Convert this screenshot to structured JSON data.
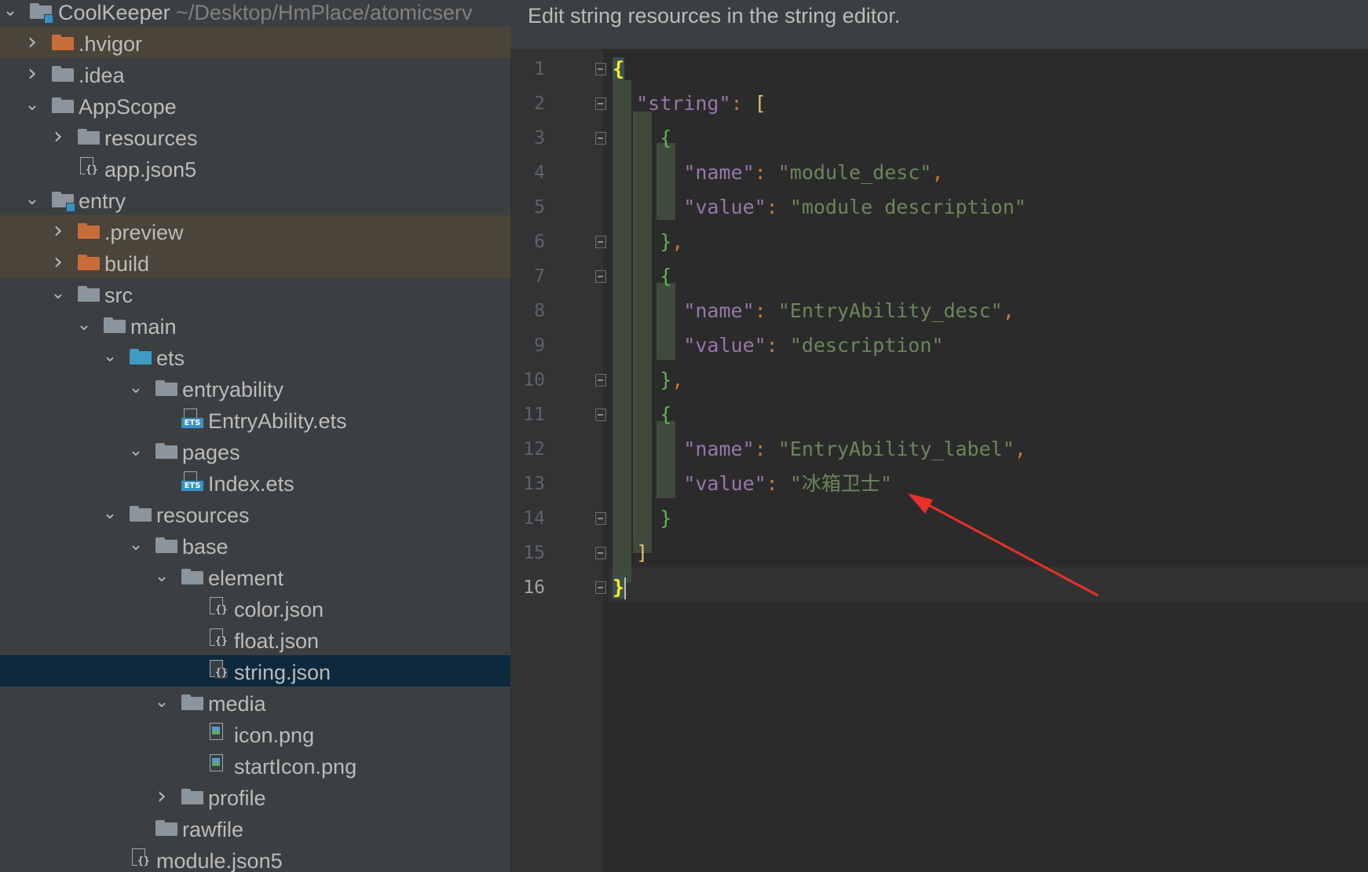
{
  "project": {
    "name": "CoolKeeper",
    "path": "~/Desktop/HmPlace/atomicserv"
  },
  "tree": [
    {
      "label": ".hvigor",
      "depth": 1,
      "icon": "folder-excluded-icon",
      "expanded": false,
      "state": "excluded"
    },
    {
      "label": ".idea",
      "depth": 1,
      "icon": "folder-icon",
      "expanded": false
    },
    {
      "label": "AppScope",
      "depth": 1,
      "icon": "folder-icon",
      "expanded": true
    },
    {
      "label": "resources",
      "depth": 2,
      "icon": "folder-icon",
      "expanded": false
    },
    {
      "label": "app.json5",
      "depth": 2,
      "icon": "json-file-icon"
    },
    {
      "label": "entry",
      "depth": 1,
      "icon": "module-folder-icon",
      "expanded": true
    },
    {
      "label": ".preview",
      "depth": 2,
      "icon": "folder-excluded-icon",
      "expanded": false,
      "state": "excluded"
    },
    {
      "label": "build",
      "depth": 2,
      "icon": "folder-excluded-icon",
      "expanded": false,
      "state": "excluded"
    },
    {
      "label": "src",
      "depth": 2,
      "icon": "folder-icon",
      "expanded": true
    },
    {
      "label": "main",
      "depth": 3,
      "icon": "folder-icon",
      "expanded": true
    },
    {
      "label": "ets",
      "depth": 4,
      "icon": "source-folder-icon",
      "expanded": true
    },
    {
      "label": "entryability",
      "depth": 5,
      "icon": "folder-icon",
      "expanded": true
    },
    {
      "label": "EntryAbility.ets",
      "depth": 6,
      "icon": "ets-file-icon"
    },
    {
      "label": "pages",
      "depth": 5,
      "icon": "folder-icon",
      "expanded": true
    },
    {
      "label": "Index.ets",
      "depth": 6,
      "icon": "ets-file-icon"
    },
    {
      "label": "resources",
      "depth": 4,
      "icon": "folder-icon",
      "expanded": true
    },
    {
      "label": "base",
      "depth": 5,
      "icon": "folder-icon",
      "expanded": true
    },
    {
      "label": "element",
      "depth": 6,
      "icon": "folder-icon",
      "expanded": true
    },
    {
      "label": "color.json",
      "depth": 7,
      "icon": "json-file-icon"
    },
    {
      "label": "float.json",
      "depth": 7,
      "icon": "json-file-icon"
    },
    {
      "label": "string.json",
      "depth": 7,
      "icon": "json-file-icon",
      "state": "selected"
    },
    {
      "label": "media",
      "depth": 6,
      "icon": "folder-icon",
      "expanded": true
    },
    {
      "label": "icon.png",
      "depth": 7,
      "icon": "image-file-icon"
    },
    {
      "label": "startIcon.png",
      "depth": 7,
      "icon": "image-file-icon"
    },
    {
      "label": "profile",
      "depth": 6,
      "icon": "folder-icon",
      "expanded": false
    },
    {
      "label": "rawfile",
      "depth": 5,
      "icon": "folder-icon"
    },
    {
      "label": "module.json5",
      "depth": 4,
      "icon": "json-file-icon"
    }
  ],
  "editor": {
    "banner": "Edit string resources in the string editor.",
    "current_line": 16,
    "line_numbers": [
      "1",
      "2",
      "3",
      "4",
      "5",
      "6",
      "7",
      "8",
      "9",
      "10",
      "11",
      "12",
      "13",
      "14",
      "15",
      "16"
    ],
    "lines": [
      {
        "n": "1",
        "text": "{"
      },
      {
        "n": "2",
        "text": "  \"string\": ["
      },
      {
        "n": "3",
        "text": "    {"
      },
      {
        "n": "4",
        "text": "      \"name\": \"module_desc\","
      },
      {
        "n": "5",
        "text": "      \"value\": \"module description\""
      },
      {
        "n": "6",
        "text": "    },"
      },
      {
        "n": "7",
        "text": "    {"
      },
      {
        "n": "8",
        "text": "      \"name\": \"EntryAbility_desc\","
      },
      {
        "n": "9",
        "text": "      \"value\": \"description\""
      },
      {
        "n": "10",
        "text": "    },"
      },
      {
        "n": "11",
        "text": "    {"
      },
      {
        "n": "12",
        "text": "      \"name\": \"EntryAbility_label\","
      },
      {
        "n": "13",
        "text": "      \"value\": \"冰箱卫士\""
      },
      {
        "n": "14",
        "text": "    }"
      },
      {
        "n": "15",
        "text": "  ]"
      },
      {
        "n": "16",
        "text": "}"
      }
    ],
    "tokens": {
      "key_string": "\"string\"",
      "key_name": "\"name\"",
      "key_value": "\"value\"",
      "colon": ": ",
      "comma": ",",
      "val_module_desc": "\"module_desc\"",
      "val_module_description": "\"module description\"",
      "val_entry_desc": "\"EntryAbility_desc\"",
      "val_description": "\"description\"",
      "val_entry_label": "\"EntryAbility_label\"",
      "val_label_cn": "\"冰箱卫士\"",
      "open_brace": "{",
      "close_brace": "}",
      "open_bracket": "[",
      "close_bracket": "]"
    }
  },
  "annotation": {
    "type": "red-arrow",
    "points_to": "\"冰箱卫士\"",
    "color": "#e8302a"
  },
  "colors": {
    "key": "#9876aa",
    "string": "#6a8759",
    "punct": "#cc7832",
    "background": "#2b2b2b",
    "selection": "#0d293e"
  }
}
